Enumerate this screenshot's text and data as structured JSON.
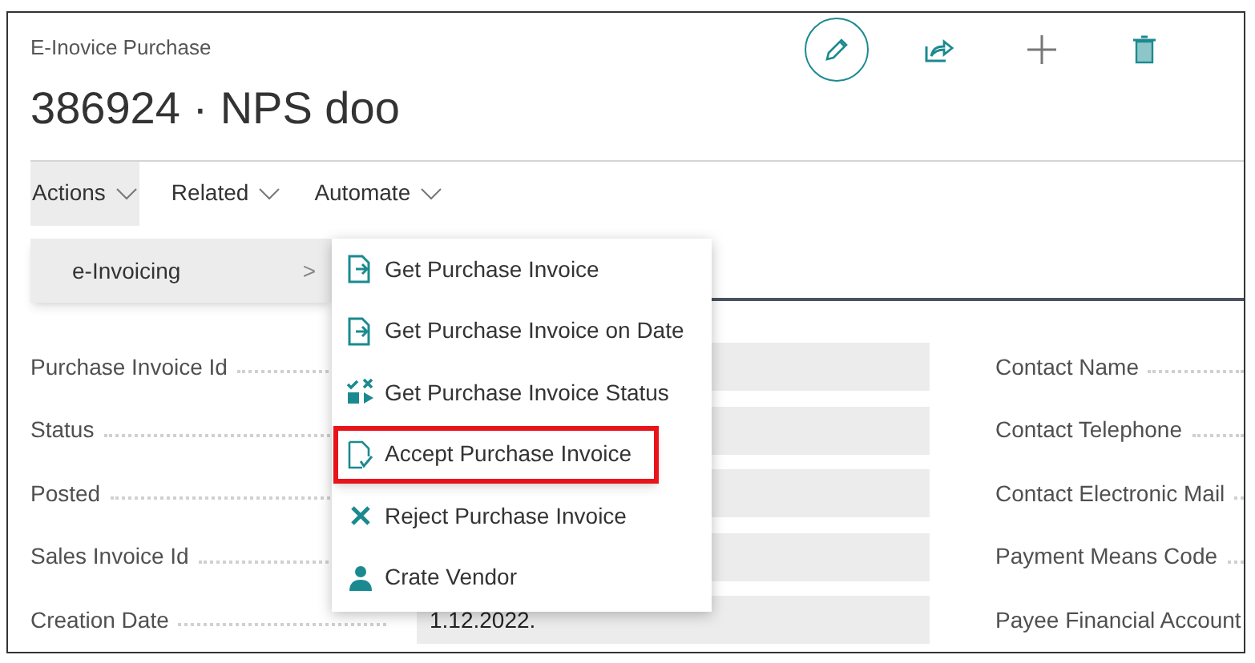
{
  "caption": "E-Inovice Purchase",
  "title": "386924 · NPS doo",
  "action_tabs": [
    {
      "label": "Actions",
      "selected": true
    },
    {
      "label": "Related",
      "selected": false
    },
    {
      "label": "Automate",
      "selected": false
    }
  ],
  "submenu": {
    "label": "e-Invoicing",
    "chevron": ">"
  },
  "menu_items": [
    {
      "label": "Get Purchase Invoice",
      "highlighted": false
    },
    {
      "label": "Get Purchase Invoice on Date",
      "highlighted": false
    },
    {
      "label": "Get Purchase Invoice Status",
      "highlighted": false
    },
    {
      "label": "Accept Purchase Invoice",
      "highlighted": true
    },
    {
      "label": "Reject Purchase Invoice",
      "highlighted": false
    },
    {
      "label": "Crate Vendor",
      "highlighted": false
    }
  ],
  "left_fields": [
    {
      "label": "Purchase Invoice Id"
    },
    {
      "label": "Status"
    },
    {
      "label": "Posted"
    },
    {
      "label": "Sales Invoice Id"
    },
    {
      "label": "Creation Date",
      "value": "1.12.2022."
    }
  ],
  "right_fields": [
    {
      "label": "Contact Name"
    },
    {
      "label": "Contact Telephone"
    },
    {
      "label": "Contact Electronic Mail"
    },
    {
      "label": "Payment Means Code"
    },
    {
      "label": "Payee Financial Account"
    }
  ]
}
